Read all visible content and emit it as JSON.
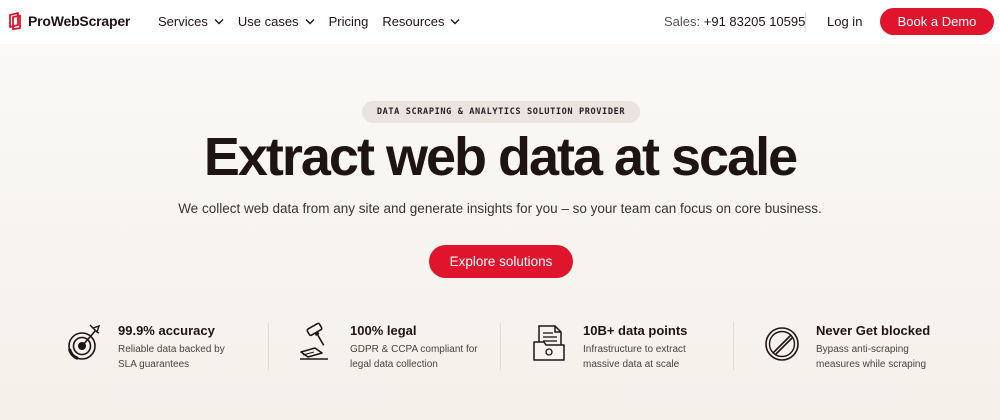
{
  "brand": {
    "name": "ProWebScraper",
    "accent": "#e0142c"
  },
  "nav": {
    "items": [
      {
        "label": "Services",
        "has_dropdown": true
      },
      {
        "label": "Use cases",
        "has_dropdown": true
      },
      {
        "label": "Pricing",
        "has_dropdown": false
      },
      {
        "label": "Resources",
        "has_dropdown": true
      }
    ],
    "sales_label": "Sales:",
    "sales_phone": "+91 83205 10595",
    "login_label": "Log in",
    "demo_label": "Book a Demo"
  },
  "hero": {
    "eyebrow": "DATA SCRAPING & ANALYTICS SOLUTION PROVIDER",
    "title": "Extract web data at scale",
    "subtitle": "We collect web data from any site and generate insights for you – so your team can focus on core business.",
    "cta_label": "Explore solutions"
  },
  "features": [
    {
      "icon": "target-icon",
      "title": "99.9% accuracy",
      "desc": "Reliable data backed by SLA guarantees"
    },
    {
      "icon": "gavel-icon",
      "title": "100% legal",
      "desc": "GDPR & CCPA compliant for legal data collection"
    },
    {
      "icon": "documents-folder-icon",
      "title": "10B+ data points",
      "desc": "Infrastructure to extract massive data at scale"
    },
    {
      "icon": "blocked-icon",
      "title": "Never Get blocked",
      "desc": "Bypass anti-scraping measures while scraping"
    }
  ]
}
